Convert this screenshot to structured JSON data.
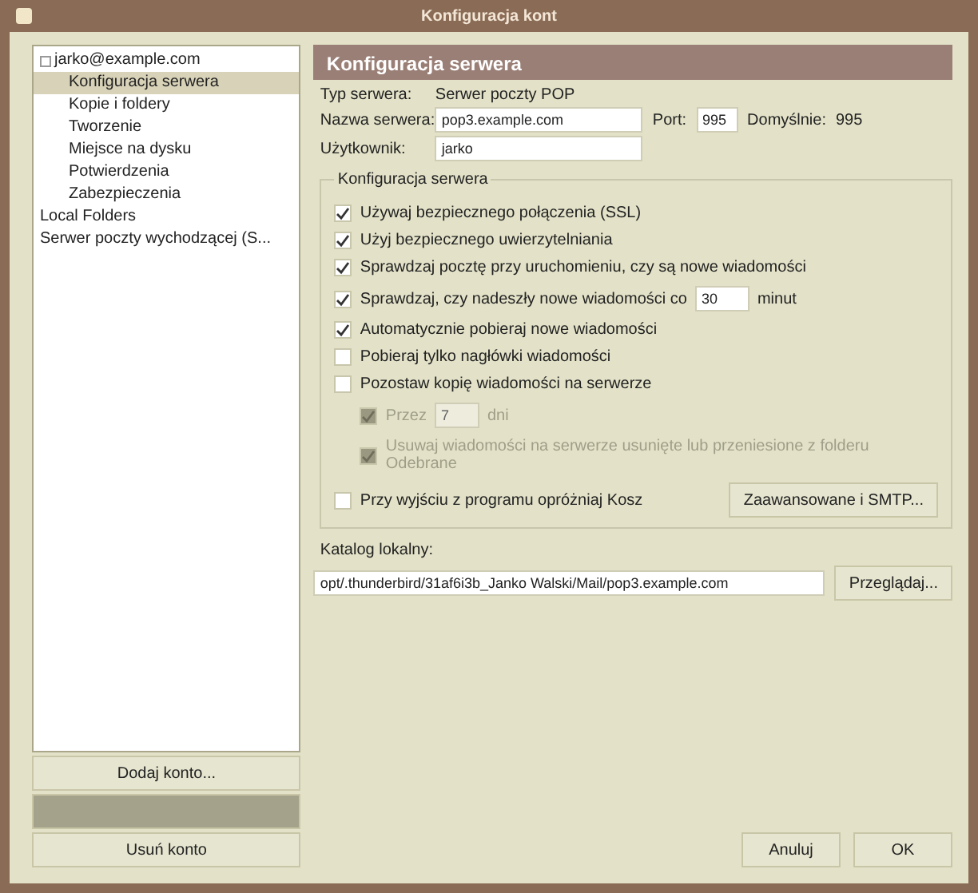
{
  "window": {
    "title": "Konfiguracja kont"
  },
  "tree": [
    {
      "label": "jarko@example.com",
      "selected": false,
      "expanded": true,
      "children": [
        {
          "label": "Konfiguracja serwera",
          "selected": true
        },
        {
          "label": "Kopie i foldery",
          "selected": false
        },
        {
          "label": "Tworzenie",
          "selected": false
        },
        {
          "label": "Miejsce na dysku",
          "selected": false
        },
        {
          "label": "Potwierdzenia",
          "selected": false
        },
        {
          "label": "Zabezpieczenia",
          "selected": false
        }
      ]
    },
    {
      "label": "Local Folders",
      "selected": false
    },
    {
      "label": "Serwer poczty wychodzącej (S...",
      "selected": false
    }
  ],
  "account_buttons": [
    {
      "label": "Dodaj konto...",
      "disabled": false
    },
    {
      "disabled": true
    },
    {
      "label": "Usuń konto",
      "disabled": false
    }
  ],
  "header": "Konfiguracja serwera",
  "server_type": {
    "label": "Typ serwera:",
    "value": "Serwer poczty POP"
  },
  "server_name": {
    "label": "Nazwa serwera:",
    "value": "pop3.example.com"
  },
  "port": {
    "label": "Port:",
    "value": "995",
    "default_label": "Domyślnie:",
    "default_value": "995"
  },
  "user": {
    "label": "Użytkownik:",
    "value": "jarko"
  },
  "settings": {
    "title": "Konfiguracja serwera",
    "options": [
      {
        "kind": "check",
        "label": "Używaj bezpiecznego połączenia (SSL)",
        "checked": true,
        "disabled": false
      },
      {
        "kind": "check",
        "label": "Użyj bezpiecznego uwierzytelniania",
        "checked": true,
        "disabled": false
      },
      {
        "kind": "check",
        "label": "Sprawdzaj pocztę przy uruchomieniu, czy są nowe wiadomości",
        "checked": true,
        "disabled": false
      },
      {
        "kind": "interval",
        "label": "Sprawdzaj, czy nadeszły nowe wiadomości co",
        "checked": true,
        "disabled": false,
        "value": "30",
        "unit": "minut"
      },
      {
        "kind": "check",
        "label": "Automatycznie pobieraj nowe wiadomości",
        "checked": true,
        "disabled": false
      },
      {
        "kind": "check",
        "label": "Pobieraj tylko nagłówki wiadomości",
        "checked": false,
        "disabled": false
      },
      {
        "kind": "check",
        "label": "Pozostaw kopię wiadomości na serwerze",
        "checked": false,
        "disabled": false
      },
      {
        "kind": "interval",
        "label": "Przez",
        "checked": true,
        "disabled": true,
        "value": "7",
        "unit": "dni",
        "sub": true
      },
      {
        "kind": "check",
        "label": "Usuwaj wiadomości na serwerze usunięte lub przeniesione z folderu Odebrane",
        "checked": true,
        "disabled": true,
        "sub": true
      },
      {
        "kind": "check",
        "label": "Przy wyjściu z programu opróżniaj Kosz",
        "checked": false,
        "disabled": false,
        "button": "Zaawansowane i SMTP..."
      }
    ]
  },
  "local_dir": {
    "label": "Katalog lokalny:",
    "value": "opt/.thunderbird/31af6i3b_Janko Walski/Mail/pop3.example.com",
    "button": "Przeglądaj..."
  },
  "buttons": [
    "Anuluj",
    "OK"
  ]
}
